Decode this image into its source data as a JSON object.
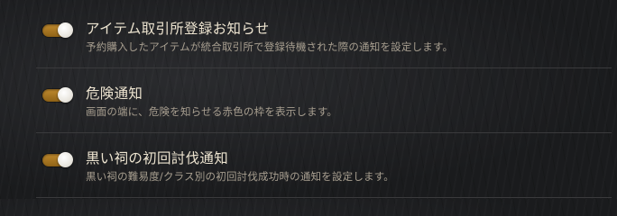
{
  "settings": [
    {
      "title": "アイテム取引所登録お知らせ",
      "description": "予約購入したアイテムが統合取引所で登録待機された際の通知を設定します。",
      "enabled": true
    },
    {
      "title": "危険通知",
      "description": "画面の端に、危険を知らせる赤色の枠を表示します。",
      "enabled": true
    },
    {
      "title": "黒い祠の初回討伐通知",
      "description": "黒い祠の難易度/クラス別の初回討伐成功時の通知を設定します。",
      "enabled": true
    }
  ],
  "colors": {
    "toggle_on": "#b07f26",
    "knob": "#ffffff",
    "title_text": "#ede4d0",
    "description_text": "#a89f90",
    "background": "#1c1d1f"
  }
}
